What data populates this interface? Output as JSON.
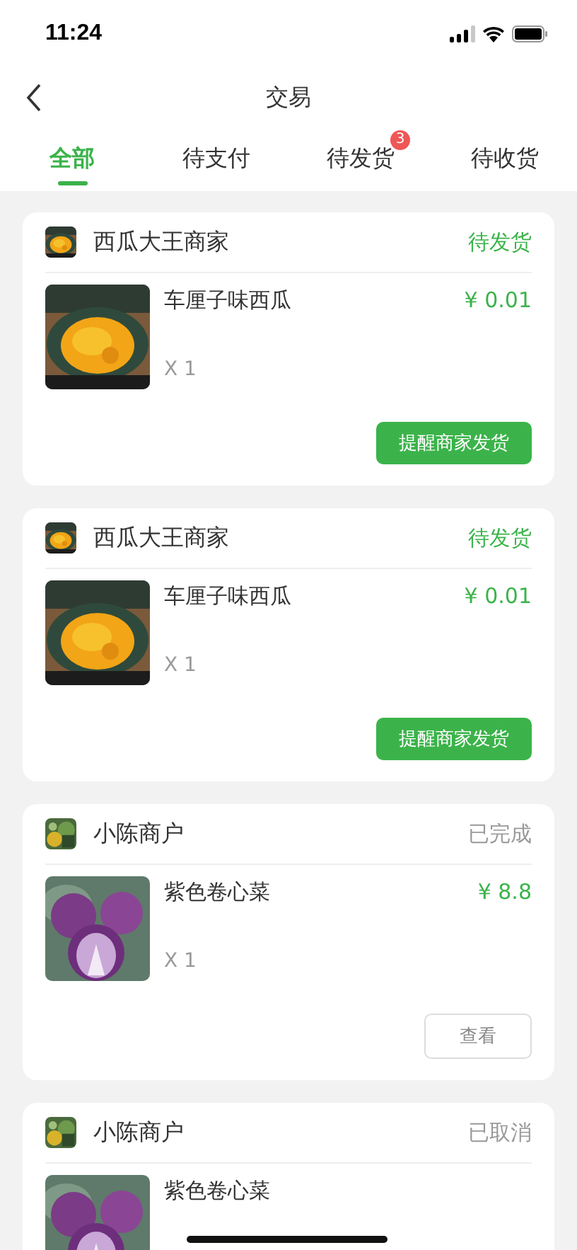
{
  "status_bar": {
    "time": "11:24"
  },
  "nav": {
    "title": "交易"
  },
  "tabs": [
    {
      "label": "全部",
      "selected": true
    },
    {
      "label": "待支付",
      "selected": false
    },
    {
      "label": "待发货",
      "selected": false,
      "badge": "3"
    },
    {
      "label": "待收货",
      "selected": false
    }
  ],
  "orders": [
    {
      "shop": "西瓜大王商家",
      "status": "待发货",
      "status_active": true,
      "product": "车厘子味西瓜",
      "price": "¥ 0.01",
      "quantity": "X 1",
      "action": {
        "label": "提醒商家发货",
        "kind": "primary"
      }
    },
    {
      "shop": "西瓜大王商家",
      "status": "待发货",
      "status_active": true,
      "product": "车厘子味西瓜",
      "price": "¥ 0.01",
      "quantity": "X 1",
      "action": {
        "label": "提醒商家发货",
        "kind": "primary"
      }
    },
    {
      "shop": "小陈商户",
      "status": "已完成",
      "status_active": false,
      "product": "紫色卷心菜",
      "price": "¥ 8.8",
      "quantity": "X 1",
      "action": {
        "label": "查看",
        "kind": "outline"
      }
    },
    {
      "shop": "小陈商户",
      "status": "已取消",
      "status_active": false,
      "product": "紫色卷心菜"
    }
  ]
}
